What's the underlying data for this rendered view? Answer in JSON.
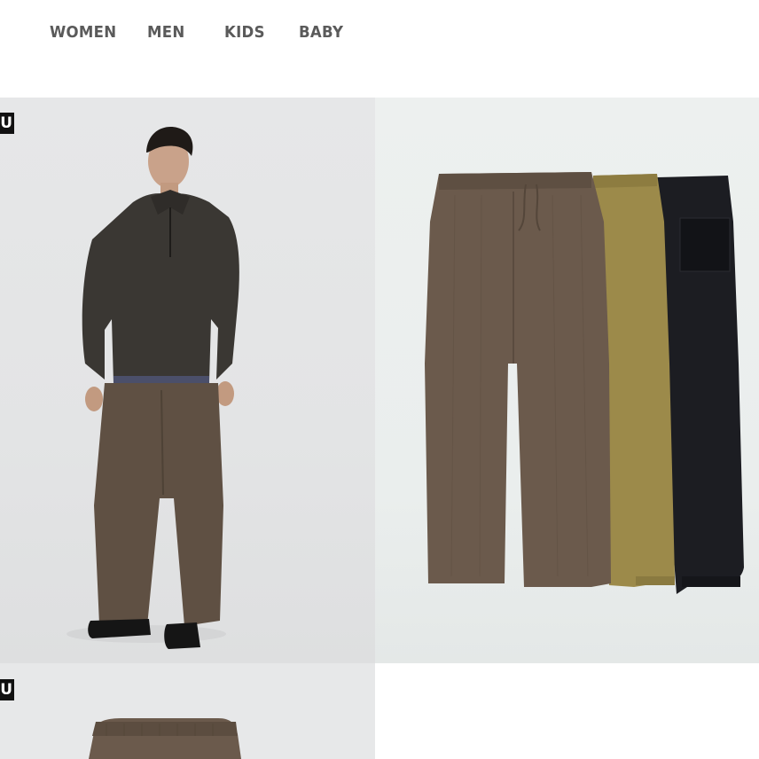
{
  "nav": {
    "items": [
      {
        "label": "WOMEN"
      },
      {
        "label": "MEN"
      },
      {
        "label": "KIDS"
      },
      {
        "label": "BABY"
      }
    ]
  },
  "tiles": [
    {
      "badge": "U",
      "image": "model-wearing-brown-corduroy-pants-and-half-zip-sweatshirt"
    },
    {
      "image": "three-corduroy-pants-brown-olive-black"
    },
    {
      "badge": "U",
      "image": "brown-corduroy-pants-waistband"
    },
    {
      "image": "blank"
    }
  ],
  "colors": {
    "nav_text": "#5a5a5a",
    "badge_bg": "#111111",
    "pants_brown": "#6b5a4c",
    "pants_olive": "#9c8a4a",
    "pants_black": "#1c1d22",
    "sweatshirt": "#3a3733"
  }
}
